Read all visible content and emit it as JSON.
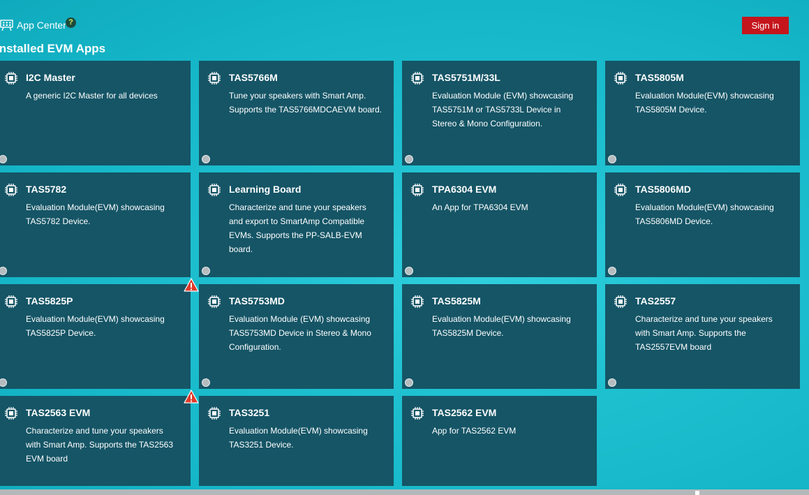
{
  "header": {
    "app_center_label": "App Center",
    "help_glyph": "?",
    "signin_label": "Sign in",
    "icons": {
      "app_center": "app-grid-icon",
      "help": "help-icon"
    }
  },
  "section_title": "Installed EVM Apps",
  "colors": {
    "background": "#14b6c8",
    "tile": "#155566",
    "signin": "#c4161c",
    "warning": "#e03a2a"
  },
  "tiles": [
    {
      "title": "I2C Master",
      "desc": "A generic I2C Master for all devices",
      "warning": false
    },
    {
      "title": "TAS5766M",
      "desc": "Tune your speakers with Smart Amp. Supports the TAS5766MDCAEVM board.",
      "warning": false
    },
    {
      "title": "TAS5751M/33L",
      "desc": "Evaluation Module (EVM) showcasing TAS5751M or TAS5733L Device in Stereo & Mono Configuration.",
      "warning": false
    },
    {
      "title": "TAS5805M",
      "desc": "Evaluation Module(EVM) showcasing TAS5805M Device.",
      "warning": false
    },
    {
      "title": "TAS5782",
      "desc": "Evaluation Module(EVM) showcasing TAS5782 Device.",
      "warning": false
    },
    {
      "title": "Learning Board",
      "desc": "Characterize and tune your speakers and export to SmartAmp Compatible EVMs. Supports the PP-SALB-EVM board.",
      "warning": false
    },
    {
      "title": "TPA6304 EVM",
      "desc": "An App for TPA6304 EVM",
      "warning": false
    },
    {
      "title": "TAS5806MD",
      "desc": "Evaluation Module(EVM) showcasing TAS5806MD Device.",
      "warning": false
    },
    {
      "title": "TAS5825P",
      "desc": "Evaluation Module(EVM) showcasing TAS5825P Device.",
      "warning": true
    },
    {
      "title": "TAS5753MD",
      "desc": "Evaluation Module (EVM) showcasing TAS5753MD Device in Stereo & Mono Configuration.",
      "warning": false
    },
    {
      "title": "TAS5825M",
      "desc": "Evaluation Module(EVM) showcasing TAS5825M Device.",
      "warning": false
    },
    {
      "title": "TAS2557",
      "desc": "Characterize and tune your speakers with Smart Amp. Supports the TAS2557EVM board",
      "warning": false
    },
    {
      "title": "TAS2563 EVM",
      "desc": "Characterize and tune your speakers with Smart Amp. Supports the TAS2563 EVM board",
      "warning": true
    },
    {
      "title": "TAS3251",
      "desc": "Evaluation Module(EVM) showcasing TAS3251 Device.",
      "warning": false
    },
    {
      "title": "TAS2562 EVM",
      "desc": "App for TAS2562 EVM",
      "warning": false
    }
  ]
}
